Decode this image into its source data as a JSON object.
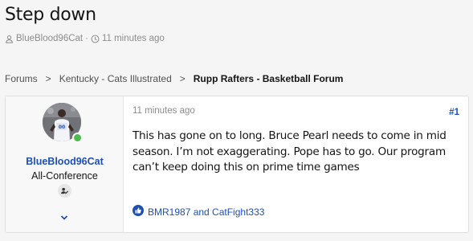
{
  "thread": {
    "title": "Step down",
    "author": "BlueBlood96Cat",
    "separator": "·",
    "time": "11 minutes ago"
  },
  "breadcrumb": {
    "items": [
      "Forums",
      "Kentucky - Cats Illustrated"
    ],
    "current": "Rupp Rafters - Basketball Forum",
    "separator": ">"
  },
  "post": {
    "username": "BlueBlood96Cat",
    "user_title": "All-Conference",
    "time": "11 minutes ago",
    "number": "#1",
    "body": "This has gone on to long. Bruce Pearl needs to come in mid season. I’m not exaggerating. Pope has to go. Our program can’t keep doing this on prime time games",
    "reactions": "BMR1987 and CatFight333"
  },
  "colors": {
    "link": "#1e4fb4",
    "online": "#4dbb4d",
    "reaction_like": "#1e4fb4"
  },
  "icons": {
    "author": "user-icon",
    "time": "clock-icon",
    "banner": "user-banner-icon",
    "expand": "chevron-down-icon",
    "reaction": "thumbs-up-icon"
  }
}
